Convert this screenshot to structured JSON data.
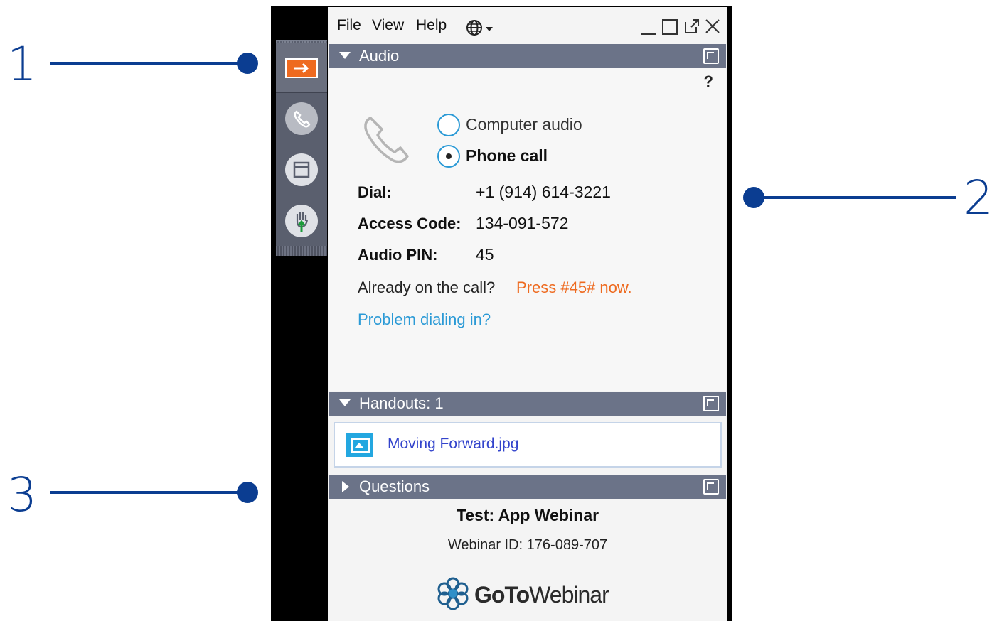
{
  "callouts": [
    "1",
    "2",
    "3"
  ],
  "menu": {
    "file": "File",
    "view": "View",
    "help": "Help",
    "language_icon": "globe-icon"
  },
  "window_controls": [
    "minimize-icon",
    "maximize-icon",
    "popout-icon",
    "close-icon"
  ],
  "toolbar": {
    "items": [
      "arrow-right-icon",
      "phone-icon",
      "window-icon",
      "raise-hand-icon"
    ]
  },
  "audio": {
    "header": "Audio",
    "help": "?",
    "options": [
      {
        "label": "Computer audio",
        "selected": false
      },
      {
        "label": "Phone call",
        "selected": true
      }
    ],
    "dial_label": "Dial:",
    "dial_value": "+1 (914) 614-3221",
    "access_label": "Access Code:",
    "access_value": "134-091-572",
    "pin_label": "Audio PIN:",
    "pin_value": "45",
    "already_text": "Already on the call?",
    "press_text": "Press #45# now.",
    "problem_link": "Problem dialing in?"
  },
  "handouts": {
    "header": "Handouts: 1",
    "file_name": "Moving Forward.jpg"
  },
  "questions": {
    "header": "Questions"
  },
  "webinar": {
    "title": "Test: App Webinar",
    "id_text": "Webinar ID: 176-089-707",
    "logo_bold": "GoTo",
    "logo_light": "Webinar"
  },
  "colors": {
    "callout": "#0b3d91",
    "section_header": "#6b7388",
    "accent_orange": "#ee6a1f",
    "link_blue": "#2b9ad6",
    "file_link": "#3344cc"
  }
}
